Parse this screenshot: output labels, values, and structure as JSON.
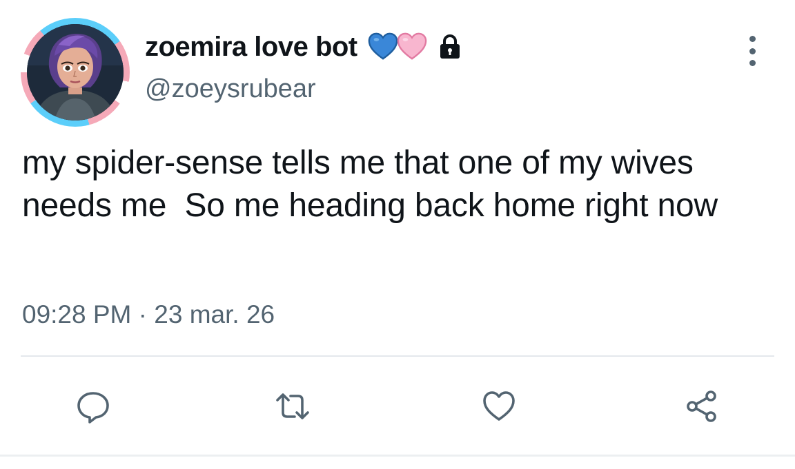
{
  "author": {
    "display_name": "zoemira love bot",
    "handle": "@zoeysrubear",
    "name_emojis": [
      "blue-heart",
      "pink-heart"
    ],
    "protected_icon": "lock-icon",
    "avatar_icon": "avatar-character",
    "avatar_ring_colors": [
      "#5bcefa",
      "#f5a9b8",
      "#ffffff"
    ]
  },
  "tweet": {
    "text": "my spider-sense tells me that one of my wives needs me  So me heading back home right now",
    "time": "09:28 PM",
    "separator": "·",
    "date": "23 mar. 26"
  },
  "more_menu": {
    "icon": "more-vertical-icon"
  },
  "actions": [
    {
      "name": "reply",
      "icon": "reply-icon"
    },
    {
      "name": "retweet",
      "icon": "retweet-icon"
    },
    {
      "name": "like",
      "icon": "heart-outline-icon"
    },
    {
      "name": "share",
      "icon": "share-icon"
    }
  ],
  "colors": {
    "text_primary": "#0f1419",
    "text_secondary": "#536471",
    "divider": "#e4e8ec",
    "icon": "#536471"
  }
}
